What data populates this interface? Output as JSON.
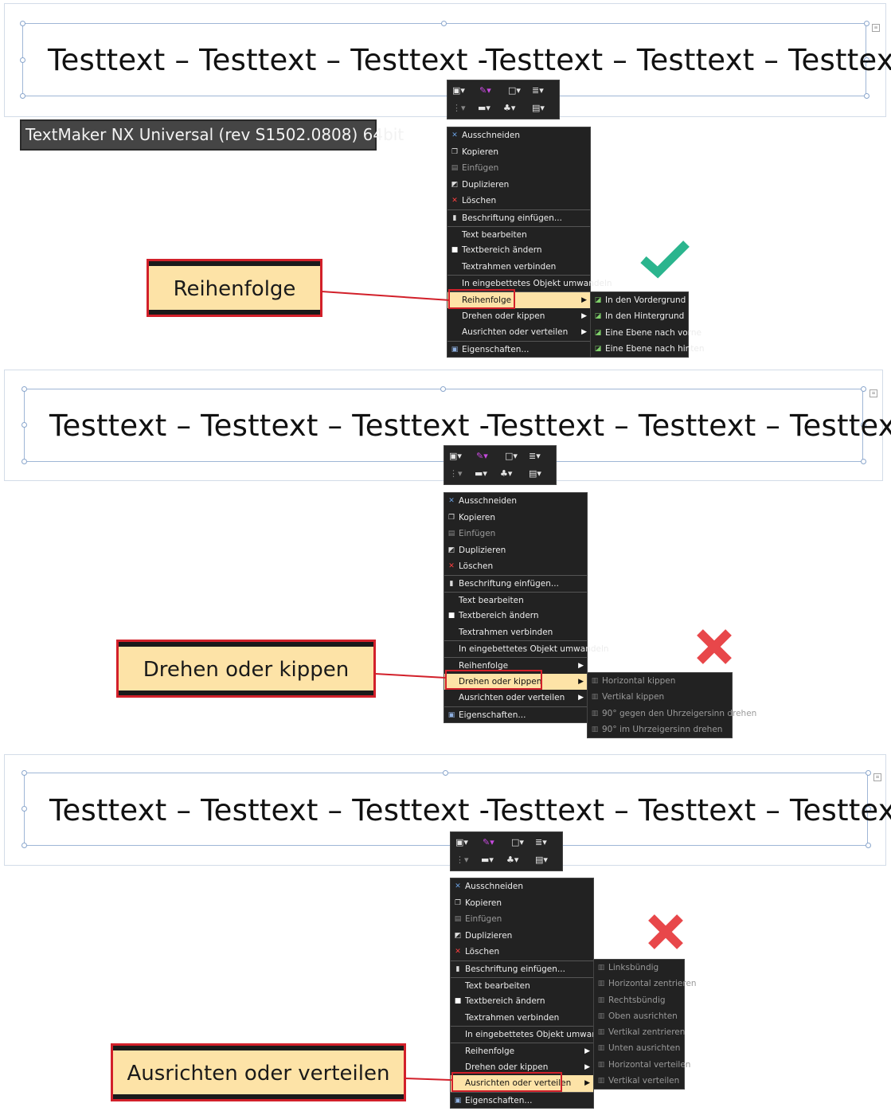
{
  "doc_text": "Testtext – Testtext – Testtext -Testtext – Testtext – Testtext",
  "tooltip": "TextMaker NX Universal (rev S1502.0808) 64bit",
  "menu_items": [
    {
      "label": "Ausschneiden",
      "icon": "cut-icon",
      "glyph": "✕",
      "disabled": false
    },
    {
      "label": "Kopieren",
      "icon": "copy-icon",
      "glyph": "❐",
      "disabled": false
    },
    {
      "label": "Einfügen",
      "icon": "paste-icon",
      "glyph": "▤",
      "disabled": true
    },
    {
      "label": "Duplizieren",
      "icon": "duplicate-icon",
      "glyph": "◩",
      "disabled": false
    },
    {
      "label": "Löschen",
      "icon": "delete-icon",
      "glyph": "✕",
      "disabled": false
    },
    {
      "label": "Beschriftung einfügen...",
      "icon": "caption-icon",
      "glyph": "▮",
      "disabled": false,
      "sep": true
    },
    {
      "label": "Text bearbeiten",
      "icon": "",
      "glyph": "",
      "disabled": false,
      "sep": true
    },
    {
      "label": "Textbereich ändern",
      "icon": "textarea-icon",
      "glyph": "■",
      "disabled": false
    },
    {
      "label": "Textrahmen verbinden",
      "icon": "",
      "glyph": "",
      "disabled": false
    },
    {
      "label": "In eingebettetes Objekt umwandeln",
      "icon": "",
      "glyph": "",
      "disabled": false,
      "sep": true
    },
    {
      "label": "Reihenfolge",
      "icon": "",
      "glyph": "",
      "disabled": false,
      "sub": true,
      "sep": true
    },
    {
      "label": "Drehen oder kippen",
      "icon": "",
      "glyph": "",
      "disabled": false,
      "sub": true
    },
    {
      "label": "Ausrichten oder verteilen",
      "icon": "",
      "glyph": "",
      "disabled": false,
      "sub": true
    },
    {
      "label": "Eigenschaften...",
      "icon": "properties-icon",
      "glyph": "▣",
      "disabled": false,
      "sep": true
    }
  ],
  "panels": [
    {
      "callout": "Reihenfolge",
      "highlight_index": 10,
      "verdict": "check",
      "submenu": [
        {
          "label": "In den Vordergrund",
          "icon": "bring-to-front-icon",
          "disabled": false
        },
        {
          "label": "In den Hintergrund",
          "icon": "send-to-back-icon",
          "disabled": false
        },
        {
          "label": "Eine Ebene nach vorne",
          "icon": "bring-forward-icon",
          "disabled": false
        },
        {
          "label": "Eine Ebene nach hinten",
          "icon": "send-backward-icon",
          "disabled": false
        }
      ]
    },
    {
      "callout": "Drehen oder kippen",
      "highlight_index": 11,
      "verdict": "cross",
      "submenu": [
        {
          "label": "Horizontal kippen",
          "icon": "flip-horizontal-icon",
          "disabled": true
        },
        {
          "label": "Vertikal kippen",
          "icon": "flip-vertical-icon",
          "disabled": true
        },
        {
          "label": "90° gegen den Uhrzeigersinn drehen",
          "icon": "rotate-ccw-icon",
          "disabled": true
        },
        {
          "label": "90° im Uhrzeigersinn drehen",
          "icon": "rotate-cw-icon",
          "disabled": true
        }
      ]
    },
    {
      "callout": "Ausrichten oder verteilen",
      "highlight_index": 12,
      "verdict": "cross",
      "submenu": [
        {
          "label": "Linksbündig",
          "icon": "align-left-icon",
          "disabled": true
        },
        {
          "label": "Horizontal zentrieren",
          "icon": "align-center-icon",
          "disabled": true
        },
        {
          "label": "Rechtsbündig",
          "icon": "align-right-icon",
          "disabled": true
        },
        {
          "label": "Oben ausrichten",
          "icon": "align-top-icon",
          "disabled": true
        },
        {
          "label": "Vertikal zentrieren",
          "icon": "align-middle-icon",
          "disabled": true
        },
        {
          "label": "Unten ausrichten",
          "icon": "align-bottom-icon",
          "disabled": true
        },
        {
          "label": "Horizontal verteilen",
          "icon": "distribute-horizontal-icon",
          "disabled": true
        },
        {
          "label": "Vertikal verteilen",
          "icon": "distribute-vertical-icon",
          "disabled": true
        }
      ]
    }
  ],
  "colors": {
    "accent_red": "#d2202a",
    "check_green": "#2bb58e",
    "cross_red": "#e8474a",
    "highlight": "#fde3a7",
    "menu_bg": "#222222"
  }
}
